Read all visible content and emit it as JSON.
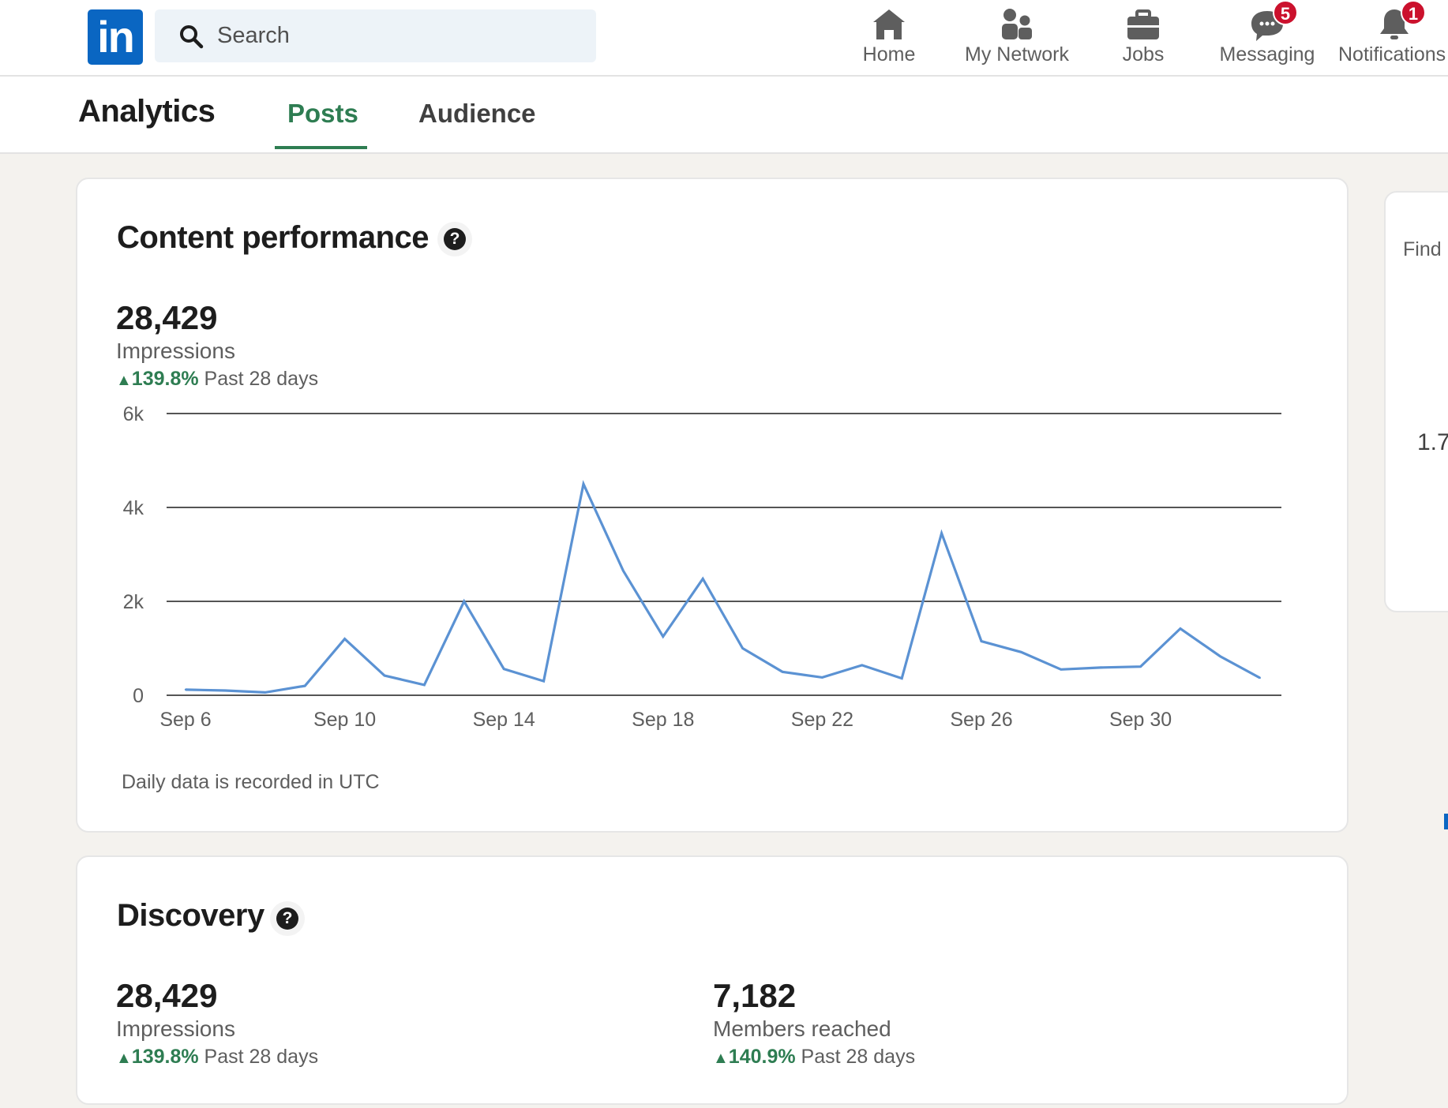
{
  "nav": {
    "search_placeholder": "Search",
    "items": [
      {
        "label": "Home",
        "icon": "home-icon"
      },
      {
        "label": "My Network",
        "icon": "network-icon"
      },
      {
        "label": "Jobs",
        "icon": "briefcase-icon"
      },
      {
        "label": "Messaging",
        "icon": "chat-icon",
        "badge": "5"
      },
      {
        "label": "Notifications",
        "icon": "bell-icon",
        "badge": "1"
      }
    ],
    "colors": {
      "brand": "#0a66c2",
      "badge": "#cb112d"
    }
  },
  "subheader": {
    "title": "Analytics",
    "tabs": [
      {
        "label": "Posts",
        "active": true
      },
      {
        "label": "Audience",
        "active": false
      }
    ],
    "accent": "#2e7d52"
  },
  "content_performance": {
    "title": "Content performance",
    "value": "28,429",
    "label": "Impressions",
    "change": "139.8%",
    "period": "Past 28 days",
    "footnote": "Daily data is recorded in UTC"
  },
  "chart_data": {
    "type": "line",
    "x": [
      "Sep 6",
      "Sep 7",
      "Sep 8",
      "Sep 9",
      "Sep 10",
      "Sep 11",
      "Sep 12",
      "Sep 13",
      "Sep 14",
      "Sep 15",
      "Sep 16",
      "Sep 17",
      "Sep 18",
      "Sep 19",
      "Sep 20",
      "Sep 21",
      "Sep 22",
      "Sep 23",
      "Sep 24",
      "Sep 25",
      "Sep 26",
      "Sep 27",
      "Sep 28",
      "Sep 29",
      "Sep 30",
      "Oct 1",
      "Oct 2",
      "Oct 3"
    ],
    "xticks": [
      "Sep 6",
      "Sep 10",
      "Sep 14",
      "Sep 18",
      "Sep 22",
      "Sep 26",
      "Sep 30"
    ],
    "series": [
      {
        "values": [
          120,
          100,
          60,
          200,
          1200,
          420,
          220,
          2000,
          560,
          300,
          4500,
          2650,
          1250,
          2480,
          1000,
          500,
          380,
          640,
          360,
          3450,
          1150,
          920,
          550,
          590,
          610,
          1420,
          830,
          370
        ],
        "color": "#5b92d3"
      }
    ],
    "yticks": [
      "0",
      "2k",
      "4k",
      "6k"
    ],
    "ylim": [
      0,
      6000
    ],
    "grid": true
  },
  "discovery": {
    "title": "Discovery",
    "metrics": [
      {
        "value": "28,429",
        "label": "Impressions",
        "change": "139.8%",
        "period": "Past 28 days"
      },
      {
        "value": "7,182",
        "label": "Members reached",
        "change": "140.9%",
        "period": "Past 28 days"
      }
    ]
  },
  "side_panel": {
    "text1": "Find",
    "text2": "1.7"
  }
}
